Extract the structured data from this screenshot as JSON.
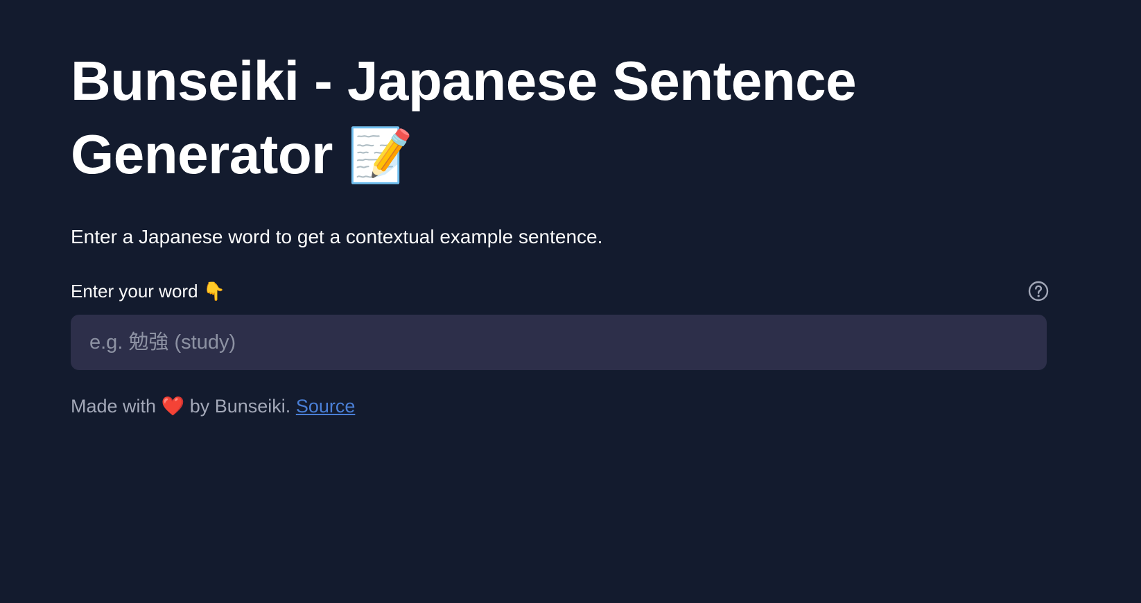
{
  "header": {
    "title": "Bunseiki - Japanese Sentence Generator",
    "title_emoji": "📝"
  },
  "description": "Enter a Japanese word to get a contextual example sentence.",
  "word_input": {
    "label": "Enter your word",
    "label_emoji": "👇",
    "value": "",
    "placeholder": "e.g. 勉強 (study)",
    "help_icon": "question-circle-icon"
  },
  "footer": {
    "prefix": "Made with",
    "heart": "❤️",
    "middle": "by Bunseiki.",
    "link_label": "Source"
  },
  "colors": {
    "background": "#131b2e",
    "input_background": "#2d2f4a",
    "link": "#4a7fd6",
    "muted_text": "#a3a8b8"
  }
}
